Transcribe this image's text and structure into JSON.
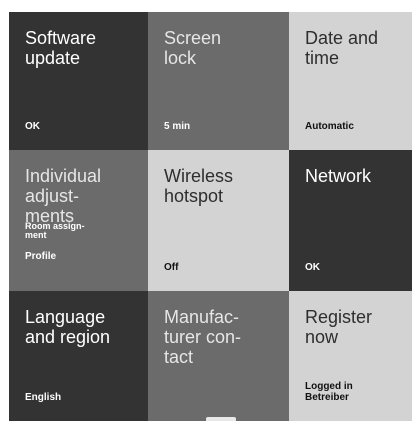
{
  "tiles": [
    {
      "title": "Software\nupdate",
      "value": "OK"
    },
    {
      "title": "Screen\nlock",
      "value": "5 min"
    },
    {
      "title": "Date and\ntime",
      "value": "Automatic"
    },
    {
      "title": "Individual\nadjust-\nments",
      "sub": "Room assign-\nment",
      "value": "Profile"
    },
    {
      "title": "Wireless\nhotspot",
      "value": "Off"
    },
    {
      "title": "Network",
      "value": "OK"
    },
    {
      "title": "Language\nand region",
      "value": "English"
    },
    {
      "title": "Manufac-\nturer con-\ntact",
      "value": ""
    },
    {
      "title": "Register\nnow",
      "value": "Logged in\nBetreiber"
    }
  ],
  "colors": {
    "dark": "#333333",
    "medium": "#6b6b6b",
    "light": "#d3d3d3"
  }
}
